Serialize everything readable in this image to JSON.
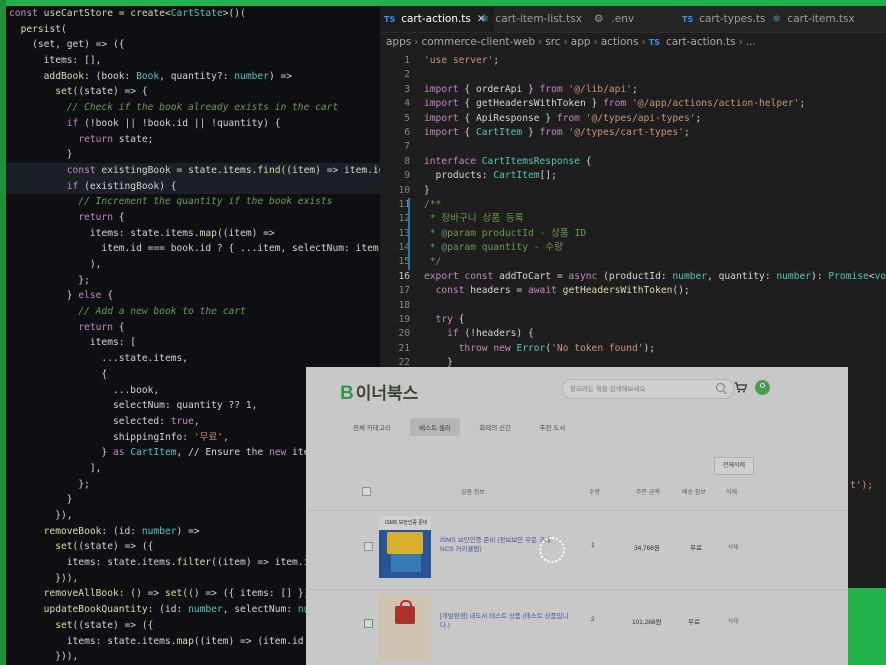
{
  "left_editor": {
    "lines": [
      "const useCartStore = create<CartState>()(",
      "  persist(",
      "    (set, get) => ({",
      "      items: [],",
      "      addBook: (book: Book, quantity?: number) =>",
      "        set((state) => {",
      "          // Check if the book already exists in the cart",
      "          if (!book || !book.id || !quantity) {",
      "            return state;",
      "          }",
      "          const existingBook = state.items.find((item) => item.id === book.id);",
      "          if (existingBook) {",
      "            // Increment the quantity if the book exists",
      "            return {",
      "              items: state.items.map((item) =>",
      "                item.id === book.id ? { ...item, selectNum: item.selectNum + quantity",
      "              ),",
      "            };",
      "          } else {",
      "            // Add a new book to the cart",
      "            return {",
      "              items: [",
      "                ...state.items,",
      "                {",
      "                  ...book,",
      "                  selectNum: quantity ?? 1,",
      "                  selected: true,",
      "                  shippingInfo: '무료',",
      "                } as CartItem, // Ensure the new item is typed as Ca",
      "              ],",
      "            };",
      "          }",
      "        }),",
      "      removeBook: (id: number) =>",
      "        set((state) => ({",
      "          items: state.items.filter((item) => item.id !== id),",
      "        })),",
      "      removeAllBook: () => set(() => ({ items: [] })),",
      "      updateBookQuantity: (id: number, selectNum: number) =>",
      "        set((state) => ({",
      "          items: state.items.map((item) => (item.id === id ? { ...it",
      "        })),"
    ]
  },
  "right_editor": {
    "tabs": [
      {
        "label": "cart-action.ts",
        "badge": "TS",
        "active": true
      },
      {
        "label": "cart-item-list.tsx",
        "badge": "⚛"
      },
      {
        "label": ".env",
        "badge": "⚙"
      },
      {
        "label": "cart-types.ts",
        "badge": "TS"
      },
      {
        "label": "cart-item.tsx",
        "badge": "⚛"
      }
    ],
    "breadcrumb": [
      "apps",
      "commerce-client-web",
      "src",
      "app",
      "actions",
      "cart-action.ts",
      "..."
    ],
    "line_numbers": [
      "1",
      "2",
      "3",
      "4",
      "5",
      "6",
      "7",
      "8",
      "9",
      "10",
      "11",
      "12",
      "13",
      "14",
      "15",
      "16",
      "17",
      "18",
      "19",
      "20",
      "21",
      "22",
      "23"
    ],
    "lines": [
      "'use server';",
      "",
      "import { orderApi } from '@/lib/api';",
      "import { getHeadersWithToken } from '@/app/actions/action-helper';",
      "import { ApiResponse } from '@/types/api-types';",
      "import { CartItem } from '@/types/cart-types';",
      "",
      "interface CartItemsResponse {",
      "  products: CartItem[];",
      "}",
      "/**",
      " * 장바구니 상품 등록",
      " * @param productId - 상품 ID",
      " * @param quantity - 수량",
      " */",
      "export const addToCart = async (productId: number, quantity: number): Promise<void",
      "  const headers = await getHeadersWithToken();",
      "",
      "  try {",
      "    if (!headers) {",
      "      throw new Error('No token found');",
      "    }",
      ""
    ],
    "tail_fragment": "t');"
  },
  "browser": {
    "logo_mark": "B",
    "logo_text": "이너북스",
    "search_placeholder": "찾으려는 책을 검색해보세요",
    "nav_tabs": [
      "전체 카테고리",
      "베스트 셀러",
      "화제의 신간",
      "추천 도서"
    ],
    "active_nav": 1,
    "bulk_button": "전체삭제",
    "columns": [
      "상품 정보",
      "수량",
      "주문 금액",
      "배송 정보",
      "삭제"
    ],
    "rows": [
      {
        "title_line1": "ISMS 보안인증 준비 (정보보안 부문 국내",
        "title_line2": "NCS 커리큘럼)",
        "cover_label": "ISMS 보안인증 준비",
        "quantity": "1",
        "price": "34,768원",
        "shipping": "무료",
        "delete": "삭제"
      },
      {
        "title_line1": "[개발환경] 내도서 테스트 상품 (테스트 상품입니",
        "title_line2": "다.)",
        "quantity": "2",
        "price": "101,268원",
        "shipping": "무료",
        "delete": "삭제"
      }
    ]
  },
  "colors": {
    "accent_green": "#22b04b",
    "editor_bg": "#1e1e1e",
    "left_editor_bg": "#0d0f12"
  }
}
